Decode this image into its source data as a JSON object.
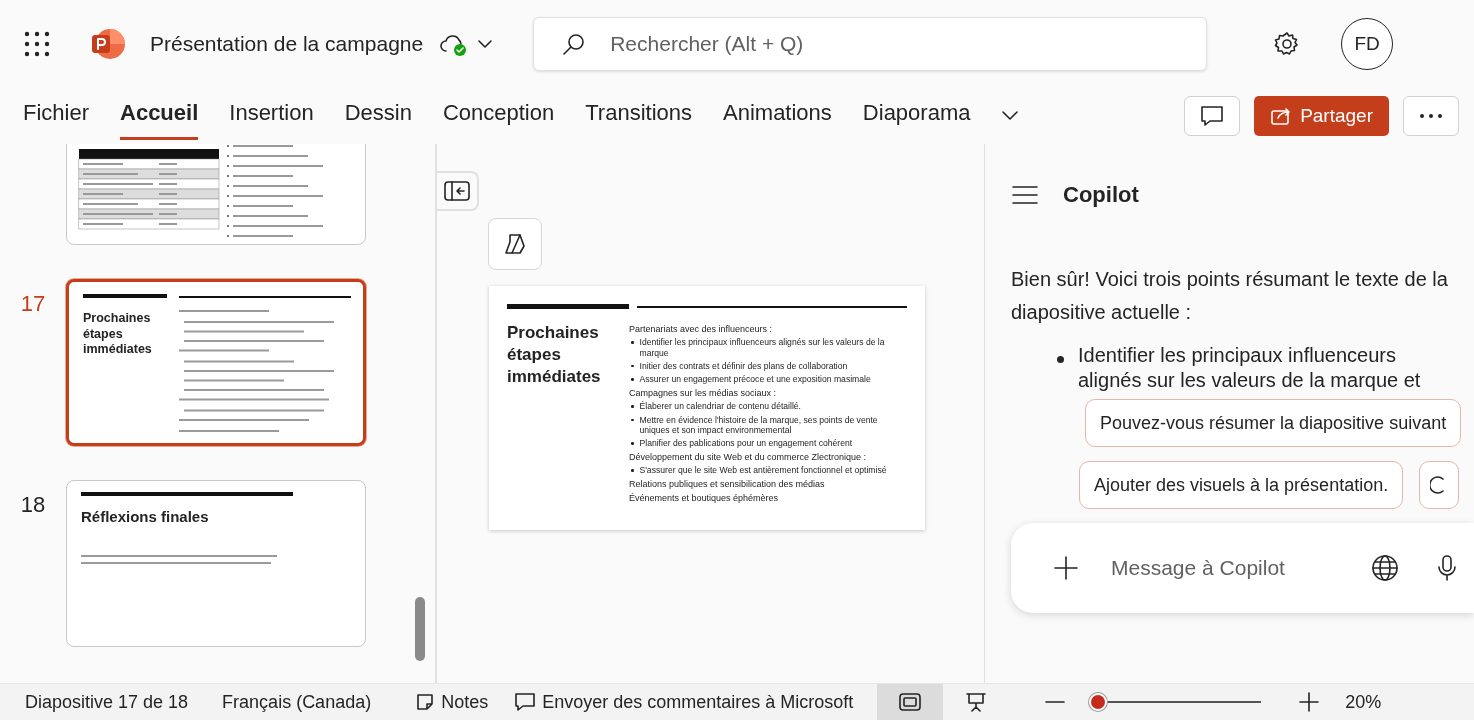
{
  "app": {
    "title": "Présentation de la campagne",
    "search": {
      "placeholder": "Rechercher (Alt + Q)"
    },
    "avatar": "FD"
  },
  "ribbon_tabs": [
    {
      "label": "Fichier",
      "selected": false
    },
    {
      "label": "Accueil",
      "selected": true
    },
    {
      "label": "Insertion",
      "selected": false
    },
    {
      "label": "Dessin",
      "selected": false
    },
    {
      "label": "Conception",
      "selected": false
    },
    {
      "label": "Transitions",
      "selected": false
    },
    {
      "label": "Animations",
      "selected": false
    },
    {
      "label": "Diaporama",
      "selected": false
    }
  ],
  "share_button": "Partager",
  "slides": [
    {
      "kind": "table",
      "selected": false
    },
    {
      "kind": "bullets",
      "number": "17",
      "title": "Prochaines étapes immédiates",
      "selected": true
    },
    {
      "kind": "paragraph",
      "number": "18",
      "title": "Réflexions finales",
      "selected": false
    }
  ],
  "current_slide": {
    "title": "Prochaines étapes immédiates",
    "body": [
      {
        "kind": "heading",
        "text": "Partenariats avec des influenceurs :"
      },
      {
        "kind": "bullet",
        "text": "Identifier les principaux influenceurs alignés sur les valeurs de la marque"
      },
      {
        "kind": "bullet",
        "text": "Initier des contrats et définir des plans de collaboration"
      },
      {
        "kind": "bullet",
        "text": "Assurer un engagement précoce et une exposition masimale"
      },
      {
        "kind": "heading",
        "text": "Campagnes sur les médias sociaux :"
      },
      {
        "kind": "bullet",
        "text": "Élaberer un calendriar de contenu détaillé."
      },
      {
        "kind": "bullet",
        "text": "Mettre en évidence l'histoire de la marque, ses points de vente uniques et son impact environmemental"
      },
      {
        "kind": "bullet",
        "text": "Planifier des pablications pour un engagement cohérent"
      },
      {
        "kind": "heading",
        "text": "Développement du site Web et du commerce Zlectronique :"
      },
      {
        "kind": "bullet",
        "text": "S'assurer que le site Web est antièrement fonctionnel et optimisé"
      },
      {
        "kind": "heading",
        "text": "Relations publiques et sensibilication des médias"
      },
      {
        "kind": "heading",
        "text": "Événements et boutiques éphémères"
      }
    ]
  },
  "copilot": {
    "title": "Copilot",
    "message": "Bien sûr! Voici trois points résumant le texte de la diapositive actuelle :",
    "points": [
      "Identifier les principaux influenceurs alignés sur les valeurs de la marque et"
    ],
    "suggestions": [
      "Pouvez-vous résumer la diapositive suivant",
      "Ajouter des visuels à la présentation."
    ],
    "input": {
      "placeholder": "Message à Copilot"
    }
  },
  "status_bar": {
    "slide_position": "Diapositive 17 de 18",
    "language": "Français (Canada)",
    "notes": "Notes",
    "feedback": "Envoyer des commentaires à Microsoft",
    "views": [
      {
        "kind": "normal",
        "selected": true
      },
      {
        "kind": "presenter",
        "selected": false
      }
    ],
    "zoom": {
      "level": 0.04,
      "reading": "20%"
    }
  }
}
